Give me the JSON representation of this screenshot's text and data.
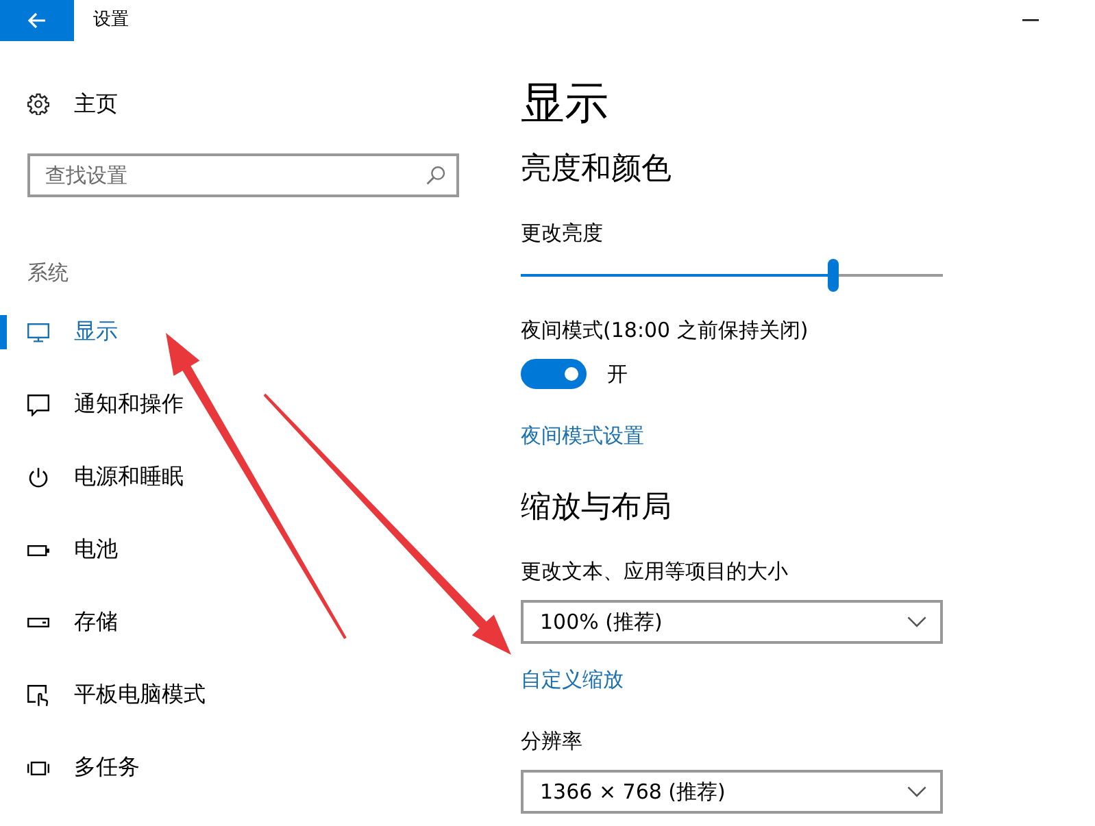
{
  "window": {
    "title": "设置"
  },
  "sidebar": {
    "home": "主页",
    "search": {
      "placeholder": "查找设置"
    },
    "section": "系统",
    "items": [
      {
        "label": "显示",
        "selected": true
      },
      {
        "label": "通知和操作",
        "selected": false
      },
      {
        "label": "电源和睡眠",
        "selected": false
      },
      {
        "label": "电池",
        "selected": false
      },
      {
        "label": "存储",
        "selected": false
      },
      {
        "label": "平板电脑模式",
        "selected": false
      },
      {
        "label": "多任务",
        "selected": false
      }
    ]
  },
  "page": {
    "title": "显示",
    "blocks": [
      {
        "kind": "section_heading",
        "text": "亮度和颜色"
      },
      {
        "kind": "slider",
        "label": "更改亮度",
        "level": 0.74
      },
      {
        "kind": "toggle",
        "label": "夜间模式(18:00 之前保持关闭)",
        "on": true,
        "state_label": "开"
      },
      {
        "kind": "link",
        "text": "夜间模式设置"
      },
      {
        "kind": "section_heading",
        "text": "缩放与布局"
      },
      {
        "kind": "dropdown",
        "label": "更改文本、应用等项目的大小",
        "value": "100% (推荐)"
      },
      {
        "kind": "link",
        "text": "自定义缩放"
      },
      {
        "kind": "dropdown",
        "label": "分辨率",
        "value": "1366 × 768 (推荐)"
      }
    ]
  }
}
